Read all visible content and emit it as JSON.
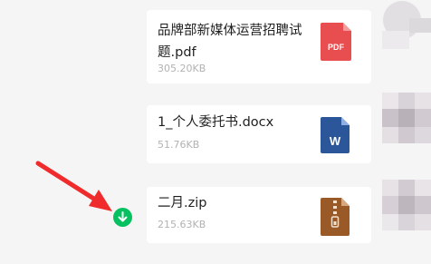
{
  "messages": [
    {
      "file_name": "品牌部新媒体运营招聘试题.pdf",
      "file_size": "305.20KB",
      "file_type": "PDF",
      "icon": "pdf-file-icon",
      "icon_color": "#e84e4f"
    },
    {
      "file_name": "1_个人委托书.docx",
      "file_size": "51.76KB",
      "file_type": "W",
      "icon": "word-file-icon",
      "icon_color": "#2b579a"
    },
    {
      "file_name": "二月.zip",
      "file_size": "215.63KB",
      "file_type": "zip",
      "icon": "zip-file-icon",
      "icon_color": "#9a5a27"
    }
  ],
  "download_indicator": {
    "icon": "download-arrow-icon",
    "color": "#07c160"
  },
  "annotation": {
    "icon": "red-pointer-arrow",
    "color": "#ef2b2b"
  }
}
